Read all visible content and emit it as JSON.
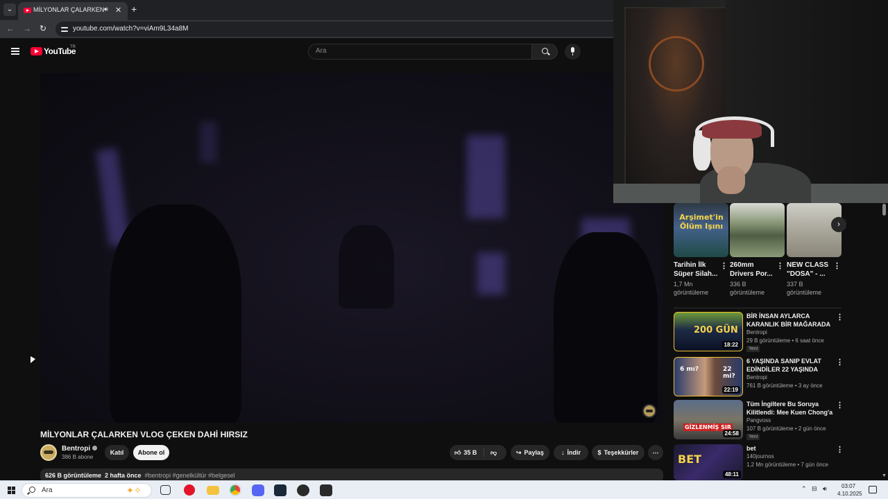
{
  "browser": {
    "tab_title": "MİLYONLAR ÇALARKEN VL",
    "url": "youtube.com/watch?v=viAm9L34a8M"
  },
  "yt_header": {
    "wordmark": "YouTube",
    "country": "TR",
    "search_placeholder": "Ara"
  },
  "video": {
    "title": "MİLYONLAR ÇALARKEN VLOG ÇEKEN DAHİ HIRSIZ",
    "channel_name": "Bentropi",
    "channel_subs": "386 B abone",
    "join_label": "Katıl",
    "subscribe_label": "Abone ol",
    "like_count": "35 B",
    "share_label": "Paylaş",
    "download_label": "İndir",
    "thanks_label": "Teşekkürler",
    "views": "626 B görüntüleme",
    "age": "2 hafta önce",
    "tags": "#bentropi #genelkültür #belgesel"
  },
  "shorts": [
    {
      "title": "Tarihin İlk Süper Silah...",
      "views": "1,7 Mn görüntüleme",
      "thumb_text": "Arşimet'in Ölüm Işını"
    },
    {
      "title": "260mm Drivers Por...",
      "views": "336 B görüntüleme"
    },
    {
      "title": "NEW CLASS \"DOSA\" - ...",
      "views": "337 B görüntüleme"
    }
  ],
  "recommendations": [
    {
      "title": "BİR İNSAN AYLARCA KARANLIK BİR MAĞARADA YAŞARSA NE ...",
      "channel": "Bentropi",
      "meta": "29 B görüntüleme • 6 saat önce",
      "badge": "Yeni",
      "duration": "18:22",
      "thumb_text": "200 GÜN"
    },
    {
      "title": "6 YAŞINDA SANIP EVLAT EDİNDİLER 22 YAŞINDA ÇIKTI",
      "channel": "Bentropi",
      "meta": "761 B görüntüleme • 3 ay önce",
      "badge": "",
      "duration": "22:19",
      "thumb_text_left": "6 mı?",
      "thumb_text_right": "22 mi?"
    },
    {
      "title": "Tüm İngiltere Bu Soruya Kilitlendi: Mee Kuen Chong'a N...",
      "channel": "Pangvoss",
      "meta": "107 B görüntüleme • 2 gün önce",
      "badge": "Yeni",
      "duration": "24:58",
      "thumb_text": "GİZLENMİŞ SIR"
    },
    {
      "title": "bet",
      "channel": "140journos",
      "meta": "1,2 Mn görüntüleme • 7 gün önce",
      "badge": "",
      "duration": "48:11",
      "thumb_text": "BET"
    }
  ],
  "taskbar": {
    "search_text": "Ara",
    "time": "03:07",
    "date": "4.10.2025"
  },
  "colors": {
    "yt_red": "#ff0033",
    "background": "#0f0f0f",
    "taskbar": "#e9eef5"
  }
}
